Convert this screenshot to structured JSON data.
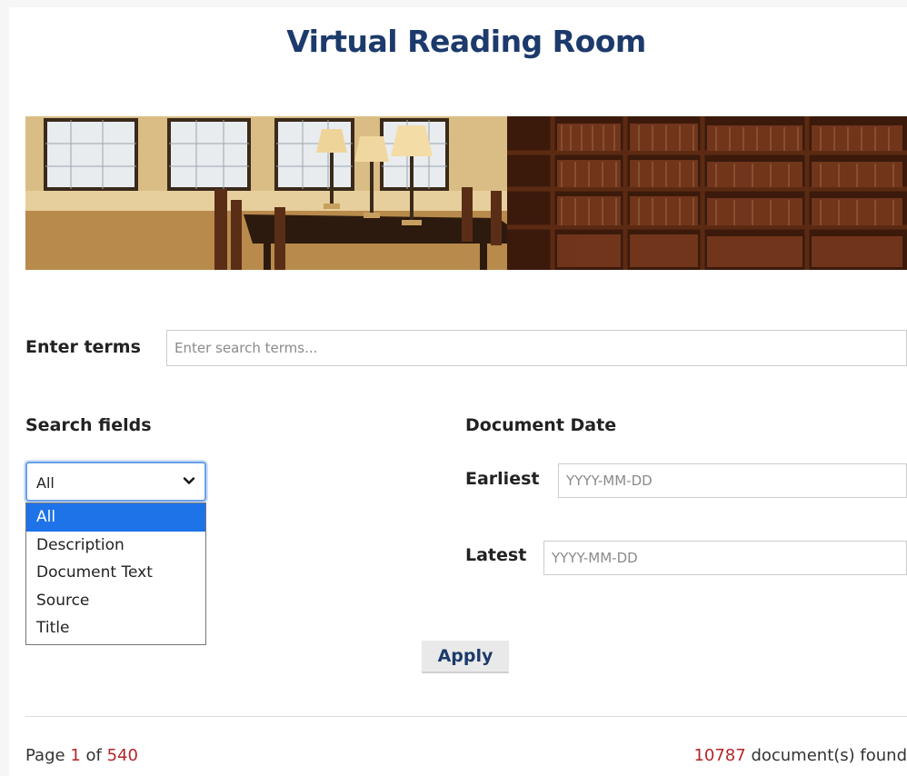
{
  "title": "Virtual Reading Room",
  "search": {
    "terms_label": "Enter terms",
    "terms_placeholder": "Enter search terms...",
    "terms_value": ""
  },
  "search_fields": {
    "heading": "Search fields",
    "selected": "All",
    "options": [
      "All",
      "Description",
      "Document Text",
      "Source",
      "Title"
    ]
  },
  "document_date": {
    "heading": "Document Date",
    "earliest_label": "Earliest",
    "earliest_placeholder": "YYYY-MM-DD",
    "latest_label": "Latest",
    "latest_placeholder": "YYYY-MM-DD"
  },
  "apply_label": "Apply",
  "pagination": {
    "page_prefix": "Page",
    "current_page": "1",
    "of_word": "of",
    "total_pages": "540"
  },
  "results": {
    "count": "10787",
    "suffix": "document(s) found"
  },
  "colors": {
    "title": "#1c3a6b",
    "number_accent": "#b3262a",
    "selected_option": "#1e73e8"
  }
}
